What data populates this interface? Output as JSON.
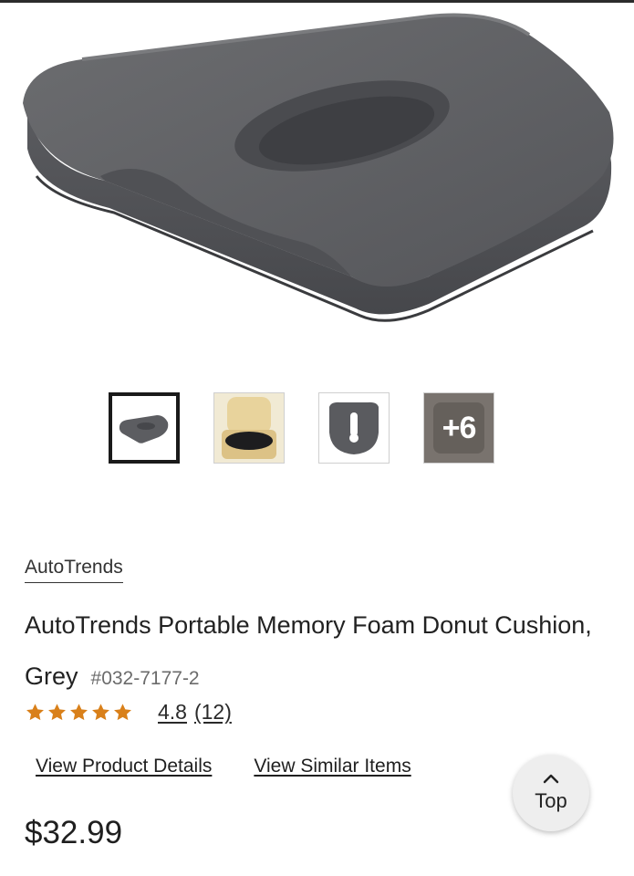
{
  "product": {
    "brand": "AutoTrends",
    "title": "AutoTrends Portable Memory Foam Donut Cushion, Grey",
    "sku": "#032-7177-2",
    "price": "$32.99"
  },
  "gallery": {
    "more_count_label": "+6",
    "selected_thumbnail": 1
  },
  "rating": {
    "stars_shown": 5,
    "value": "4.8",
    "count": "(12)"
  },
  "links": {
    "details": "View Product Details",
    "similar": "View Similar Items"
  },
  "top_button": {
    "label": "Top"
  },
  "colors": {
    "star": "#d9801a",
    "cushion": "#5f6063",
    "text": "#1f1f1f"
  }
}
